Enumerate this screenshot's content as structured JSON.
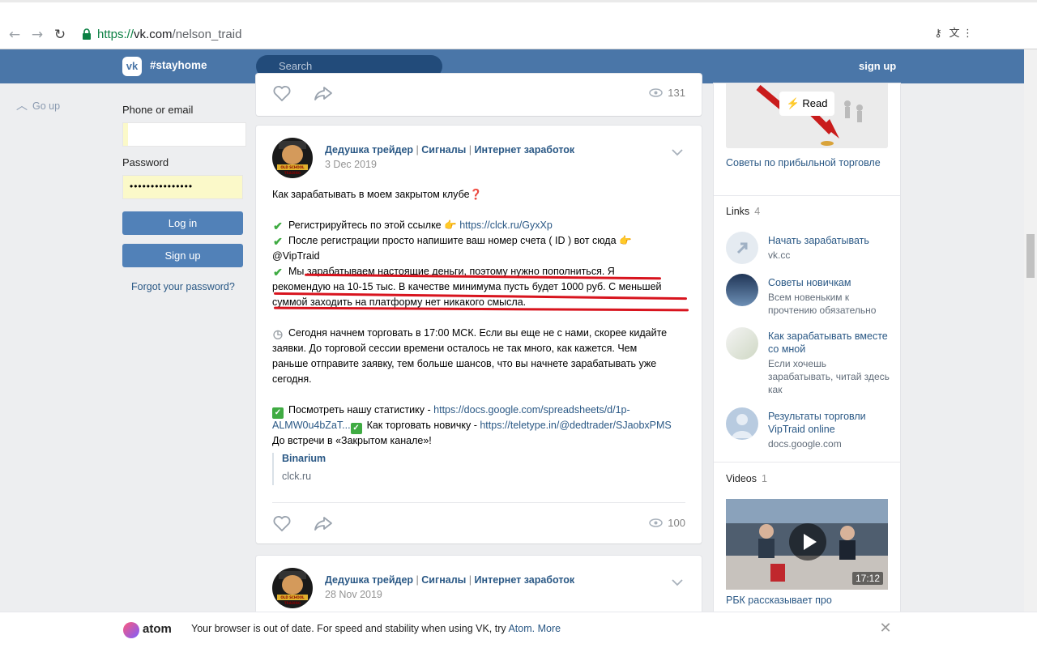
{
  "browser": {
    "url_protocol": "https://",
    "url_host": "vk.com",
    "url_path": "/nelson_traid"
  },
  "header": {
    "logo": "vk",
    "tag": "#stayhome",
    "search_placeholder": "Search",
    "signup": "sign up"
  },
  "left": {
    "go_up": "Go up",
    "phone_label": "Phone or email",
    "phone_value": "",
    "password_label": "Password",
    "password_value": "•••••••••••••••",
    "login_button": "Log in",
    "signup_button": "Sign up",
    "forgot": "Forgot your password?"
  },
  "post_top": {
    "views": "131"
  },
  "post1": {
    "author": "Дедушка трейдер",
    "author_parts": [
      "Сигналы",
      "Интернет заработок"
    ],
    "date": "3 Dec 2019",
    "avatar_text": "OLD SCHOOL TRADING",
    "lines": {
      "l1": "Как зарабатывать в моем закрытом клубе",
      "l1_emoji": "❓",
      "l2_text": "Регистрируйтесь по этой ссылке",
      "l2_hand": "👉",
      "l2_link": "https://clck.ru/GyxXp",
      "l3_text": "После регистрации просто напишите ваш номер счета ( ID ) вот сюда",
      "l3_hand": "👉",
      "l4": "@VipTraid",
      "l5": "Мы зарабатываем настоящие деньги, поэтому нужно пополниться. Я",
      "l6": "рекомендую на 10-15 тыс. В качестве минимума пусть будет 1000 руб. С меньшей",
      "l7": "суммой заходить на платформу нет никакого смысла.",
      "l8": "Сегодня начнем торговать в 17:00 МСК. Если вы еще не с нами, скорее кидайте",
      "l9": "заявки. До торговой сессии времени осталось не так много, как кажется. Чем",
      "l10": "раньше отправите заявку, тем больше шансов, что вы начнете зарабатывать уже",
      "l11": "сегодня.",
      "l12_text": "Посмотреть нашу статистику -",
      "l12_link": "https://docs.google.com/spreadsheets/d/1p-",
      "l13_link": "ALMW0u4bZaT...",
      "l13_text": "Как торговать новичку -",
      "l13_link2": "https://teletype.in/@dedtrader/SJaobxPMS",
      "l14": "До встречи в «Закрытом канале»!"
    },
    "snippet_title": "Binarium",
    "snippet_host": "clck.ru",
    "views": "100"
  },
  "post2": {
    "author": "Дедушка трейдер",
    "author_parts": [
      "Сигналы",
      "Интернет заработок"
    ],
    "date": "28 Nov 2019"
  },
  "sidebar": {
    "read_button": "Read",
    "article_caption": "Советы по прибыльной торговле",
    "links_title": "Links",
    "links_count": "4",
    "links": [
      {
        "title": "Начать зарабатывать",
        "sub": "vk.cc"
      },
      {
        "title": "Советы новичкам",
        "sub": "Всем новеньким к прочтению обязательно"
      },
      {
        "title": "Как зарабатывать вместе со мной",
        "sub": "Если хочешь зарабатывать, читай здесь как"
      },
      {
        "title": "Результаты торговли VipTraid online",
        "sub": "docs.google.com"
      }
    ],
    "videos_title": "Videos",
    "videos_count": "1",
    "video_duration": "17:12",
    "video_caption": "РБК рассказывает про"
  },
  "banner": {
    "brand": "atom",
    "message": "Your browser is out of date. For speed and stability when using VK, try",
    "atom_link": "Atom.",
    "more_link": "More"
  },
  "colors": {
    "vk_blue": "#4a76a8",
    "link": "#2a5885",
    "highlight_red": "#d8141e",
    "check_green": "#3fab42"
  }
}
